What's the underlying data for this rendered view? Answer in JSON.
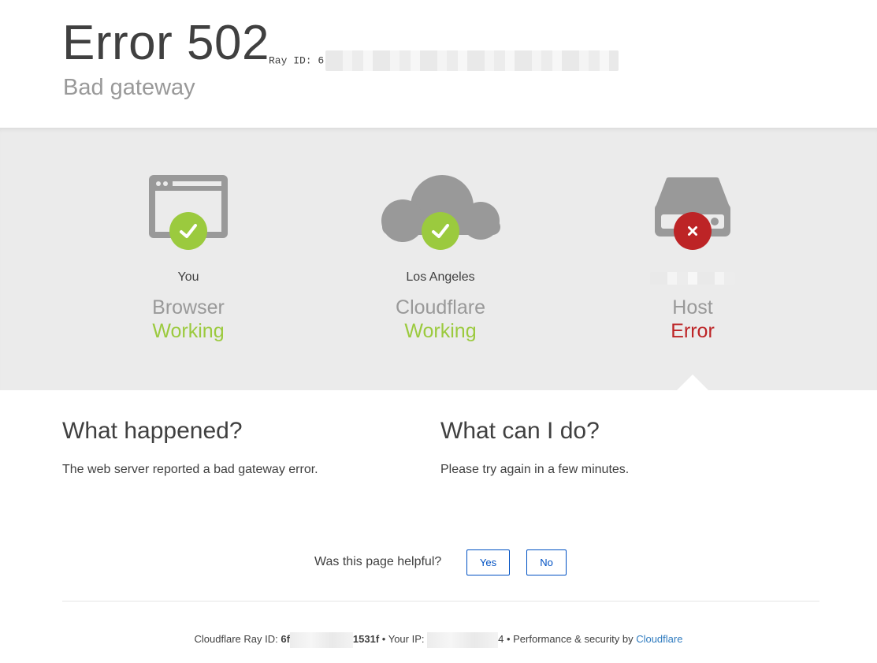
{
  "header": {
    "error_title": "Error 502",
    "ray_label": "Ray ID: 6",
    "subtitle": "Bad gateway"
  },
  "nodes": [
    {
      "location": "You",
      "type": "Browser",
      "status": "Working",
      "status_kind": "ok",
      "icon": "browser-icon"
    },
    {
      "location": "Los Angeles",
      "type": "Cloudflare",
      "status": "Working",
      "status_kind": "ok",
      "icon": "cloud-icon"
    },
    {
      "location": "",
      "type": "Host",
      "status": "Error",
      "status_kind": "error",
      "icon": "server-icon"
    }
  ],
  "what_happened": {
    "heading": "What happened?",
    "body": "The web server reported a bad gateway error."
  },
  "what_can_i_do": {
    "heading": "What can I do?",
    "body": "Please try again in a few minutes."
  },
  "feedback": {
    "question": "Was this page helpful?",
    "yes_label": "Yes",
    "no_label": "No"
  },
  "footer": {
    "ray_label": "Cloudflare Ray ID: ",
    "ray_prefix": "6f",
    "ray_suffix": "1531f",
    "sep1": " • ",
    "ip_label": "Your IP: ",
    "ip_suffix": "4",
    "sep2": " • ",
    "perf_label": "Performance & security by ",
    "cf_link": "Cloudflare"
  },
  "colors": {
    "working": "#9bca3e",
    "error": "#bd2426",
    "link": "#2f7bbf",
    "button": "#0051c3",
    "icon_gray": "#999999"
  }
}
